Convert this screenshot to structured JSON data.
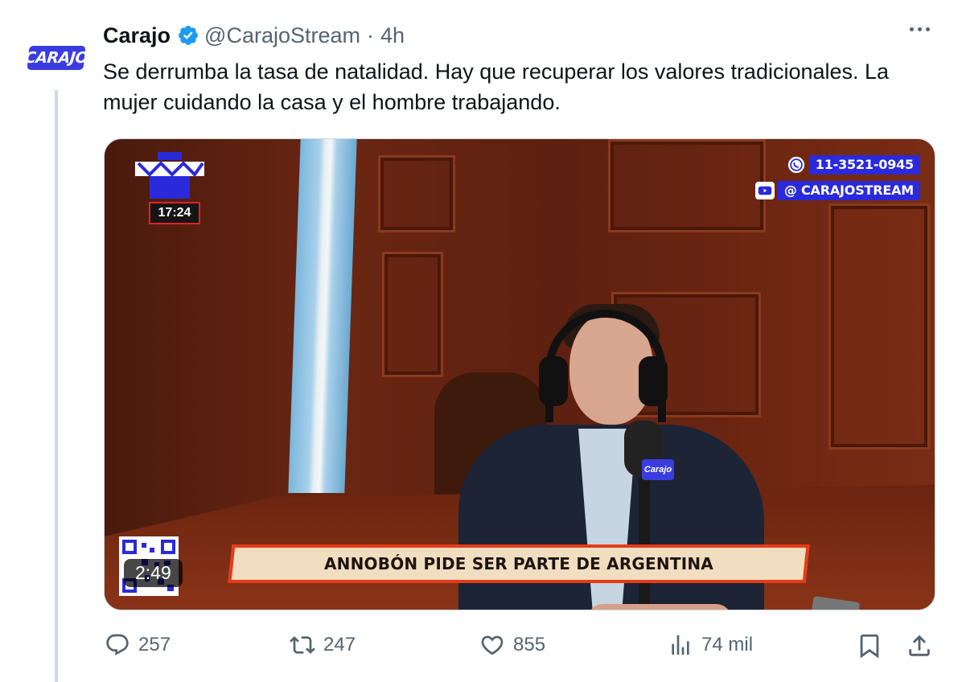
{
  "tweet": {
    "author_name": "Carajo",
    "handle": "@CarajoStream",
    "separator": "·",
    "time": "4h",
    "avatar_text": "CARAJO",
    "text": "Se derrumba la tasa de natalidad. Hay que recuperar los valores tradicionales. La mujer cuidando la casa y el hombre trabajando."
  },
  "video": {
    "clock": "17:24",
    "whatsapp_number": "11-3521-0945",
    "youtube_handle": "@ CARAJOSTREAM",
    "headline": "ANNOBÓN PIDE SER PARTE DE ARGENTINA",
    "duration": "2:49",
    "mic_badge": "Carajo"
  },
  "actions": {
    "replies": "257",
    "reposts": "247",
    "likes": "855",
    "views": "74 mil"
  },
  "icons": {
    "verified": "verified-badge-icon",
    "reply": "reply-icon",
    "repost": "repost-icon",
    "like": "heart-icon",
    "views": "views-icon",
    "bookmark": "bookmark-icon",
    "share": "share-icon",
    "more": "more-icon"
  },
  "colors": {
    "verified": "#1d9bf0",
    "muted": "#536471",
    "brand_blue": "#3b3ce0",
    "headline_border": "#e63b1a"
  }
}
